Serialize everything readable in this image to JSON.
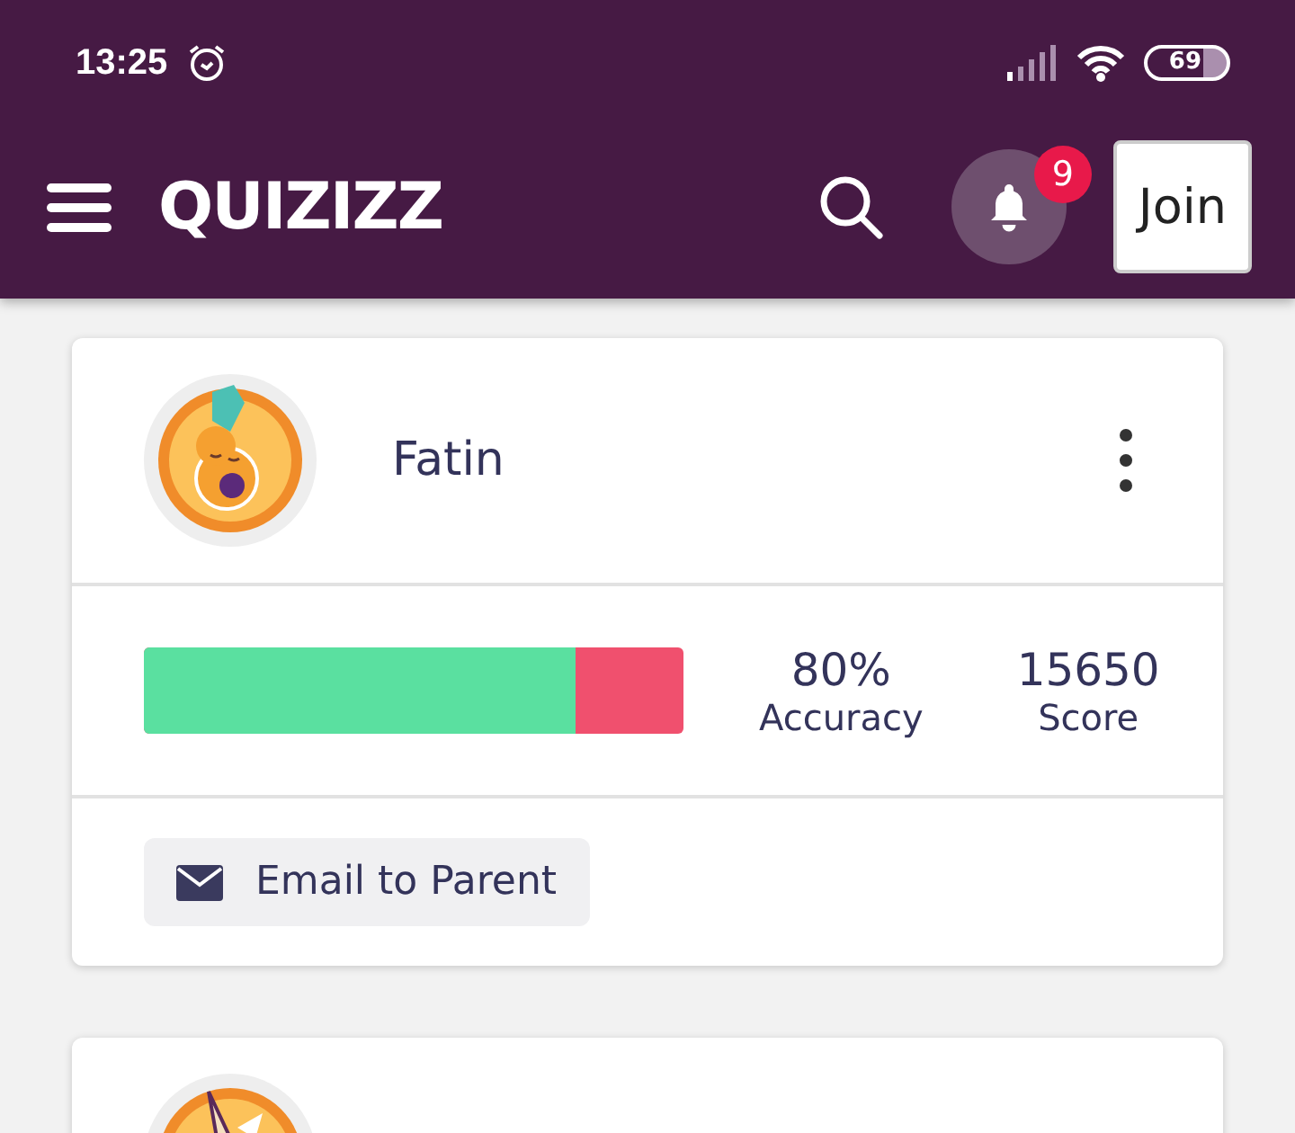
{
  "status_bar": {
    "time": "13:25",
    "battery": "69"
  },
  "header": {
    "logo": "QUIZIZZ",
    "notification_count": "9",
    "join_button": "Join"
  },
  "players": [
    {
      "name": "Fatin",
      "level": 0.8,
      "accuracy": "80%",
      "accuracy_label": "Accuracy",
      "score": "15650",
      "score_label": "Score",
      "email_button": "Email to Parent"
    },
    {
      "kind": "partial"
    }
  ]
}
